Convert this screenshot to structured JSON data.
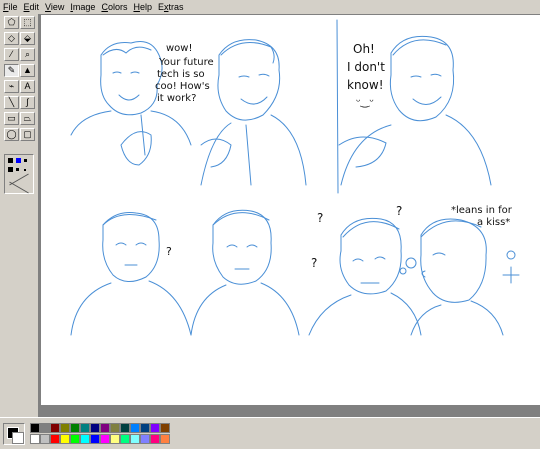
{
  "menu": [
    {
      "u": "F",
      "rest": "ile"
    },
    {
      "u": "E",
      "rest": "dit"
    },
    {
      "u": "V",
      "rest": "iew"
    },
    {
      "u": "I",
      "rest": "mage"
    },
    {
      "u": "C",
      "rest": "olors"
    },
    {
      "u": "H",
      "rest": "elp"
    },
    {
      "pre": "E",
      "u": "x",
      "rest": "tras"
    }
  ],
  "tools": [
    {
      "name": "free-select-icon",
      "glyph": "⬠"
    },
    {
      "name": "rect-select-icon",
      "glyph": "⬚"
    },
    {
      "name": "eraser-icon",
      "glyph": "◇"
    },
    {
      "name": "fill-icon",
      "glyph": "⬙"
    },
    {
      "name": "color-picker-icon",
      "glyph": "⁄"
    },
    {
      "name": "magnifier-icon",
      "glyph": "⌕"
    },
    {
      "name": "pencil-icon",
      "glyph": "✎"
    },
    {
      "name": "brush-icon",
      "glyph": "▲"
    },
    {
      "name": "airbrush-icon",
      "glyph": "⌁"
    },
    {
      "name": "text-icon",
      "glyph": "A"
    },
    {
      "name": "line-icon",
      "glyph": "╲"
    },
    {
      "name": "curve-icon",
      "glyph": "∫"
    },
    {
      "name": "rectangle-icon",
      "glyph": "▭"
    },
    {
      "name": "polygon-icon",
      "glyph": "⏢"
    },
    {
      "name": "ellipse-icon",
      "glyph": "◯"
    },
    {
      "name": "rounded-rect-icon",
      "glyph": "▢"
    }
  ],
  "palette": {
    "foreground": "#000000",
    "background": "#ffffff",
    "colors_top": [
      "#000000",
      "#808080",
      "#800000",
      "#808000",
      "#008000",
      "#008080",
      "#000080",
      "#800080",
      "#808040",
      "#004040",
      "#0080ff",
      "#004080",
      "#8000ff",
      "#804000"
    ],
    "colors_bottom": [
      "#ffffff",
      "#c0c0c0",
      "#ff0000",
      "#ffff00",
      "#00ff00",
      "#00ffff",
      "#0000ff",
      "#ff00ff",
      "#ffff80",
      "#00ff80",
      "#80ffff",
      "#8080ff",
      "#ff0080",
      "#ff8040"
    ]
  },
  "drawing": {
    "stroke_color": "#4a8fd6",
    "panel1_speech": [
      "wow!",
      "Your future",
      "tech is so",
      "coo! How's",
      "it work?"
    ],
    "panel2_speech": [
      "Oh!",
      "I don't",
      "know!"
    ],
    "panel3_speech": "?",
    "panel4_speech": [
      "?",
      "?",
      "?"
    ],
    "panel4_caption": [
      "*leans in for",
      "a kiss*"
    ]
  }
}
